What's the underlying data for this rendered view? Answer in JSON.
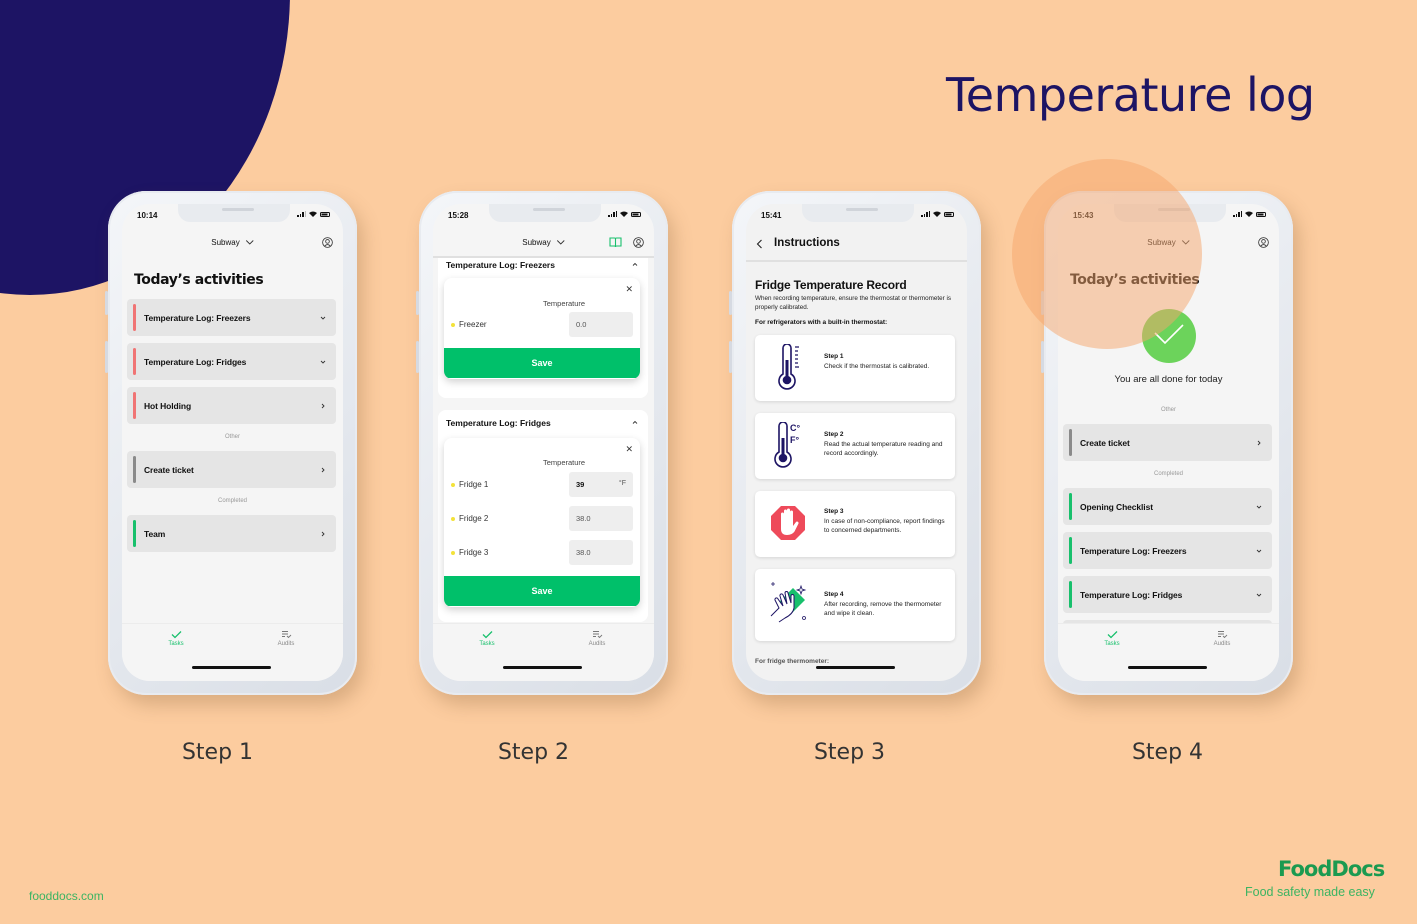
{
  "page": {
    "title": "Temperature log",
    "footer_url": "fooddocs.com",
    "brand": "FoodDocs",
    "tagline": "Food safety made easy",
    "colors": {
      "background": "#fccc9f",
      "navy": "#1d1464",
      "brand_green": "#1b9a50",
      "save_green": "#00c06a",
      "pending_red": "#f07474",
      "other_gray": "#8a8a8a",
      "done_green": "#18c06c"
    }
  },
  "steps": [
    "Step 1",
    "Step 2",
    "Step 3",
    "Step 4"
  ],
  "tabbar": {
    "tasks": "Tasks",
    "audits": "Audits"
  },
  "phone1": {
    "time": "10:14",
    "store": "Subway",
    "heading": "Today’s activities",
    "tasks": [
      {
        "label": "Temperature Log: Freezers",
        "status": "pending",
        "icon": "chevron-down"
      },
      {
        "label": "Temperature Log: Fridges",
        "status": "pending",
        "icon": "chevron-down"
      },
      {
        "label": "Hot Holding",
        "status": "pending",
        "icon": "chevron-right"
      }
    ],
    "other_label": "Other",
    "other": [
      {
        "label": "Create ticket",
        "icon": "chevron-right"
      }
    ],
    "completed_label": "Completed",
    "completed": [
      {
        "label": "Team",
        "icon": "chevron-right"
      }
    ]
  },
  "phone2": {
    "time": "15:28",
    "store": "Subway",
    "freezers": {
      "title": "Temperature Log: Freezers",
      "column": "Temperature",
      "rows": [
        {
          "name": "Freezer",
          "value": "",
          "placeholder": "0.0"
        }
      ],
      "save": "Save"
    },
    "fridges": {
      "title": "Temperature Log: Fridges",
      "column": "Temperature",
      "rows": [
        {
          "name": "Fridge 1",
          "value": "39",
          "unit": "°F",
          "placeholder": ""
        },
        {
          "name": "Fridge 2",
          "value": "",
          "placeholder": "38.0"
        },
        {
          "name": "Fridge 3",
          "value": "",
          "placeholder": "38.0"
        }
      ],
      "save": "Save"
    }
  },
  "phone3": {
    "time": "15:41",
    "nav_title": "Instructions",
    "doc_title": "Fridge Temperature Record",
    "intro": "When recording temperature, ensure the thermostat or thermometer is properly calibrated.",
    "subheading": "For refrigerators with a built-in thermostat:",
    "cards": [
      {
        "title": "Step 1",
        "text": "Check if the thermostat is calibrated.",
        "icon": "thermometer-icon"
      },
      {
        "title": "Step 2",
        "text": "Read the actual temperature reading and record accordingly.",
        "icon": "thermometer-celsius-fahrenheit-icon"
      },
      {
        "title": "Step 3",
        "text": "In case of non-compliance, report findings to concerned departments.",
        "icon": "stop-hand-icon"
      },
      {
        "title": "Step 4",
        "text": "After recording, remove the thermometer and wipe it clean.",
        "icon": "wipe-clean-icon"
      }
    ],
    "subheading2": "For fridge thermometer:"
  },
  "phone4": {
    "time": "15:43",
    "store": "Subway",
    "heading": "Today’s activities",
    "done_text": "You are all done for today",
    "other_label": "Other",
    "other": [
      {
        "label": "Create ticket",
        "icon": "chevron-right"
      }
    ],
    "completed_label": "Completed",
    "completed": [
      {
        "label": "Opening Checklist",
        "icon": "chevron-down"
      },
      {
        "label": "Temperature Log: Freezers",
        "icon": "chevron-down"
      },
      {
        "label": "Temperature Log: Fridges",
        "icon": "chevron-down"
      }
    ]
  }
}
